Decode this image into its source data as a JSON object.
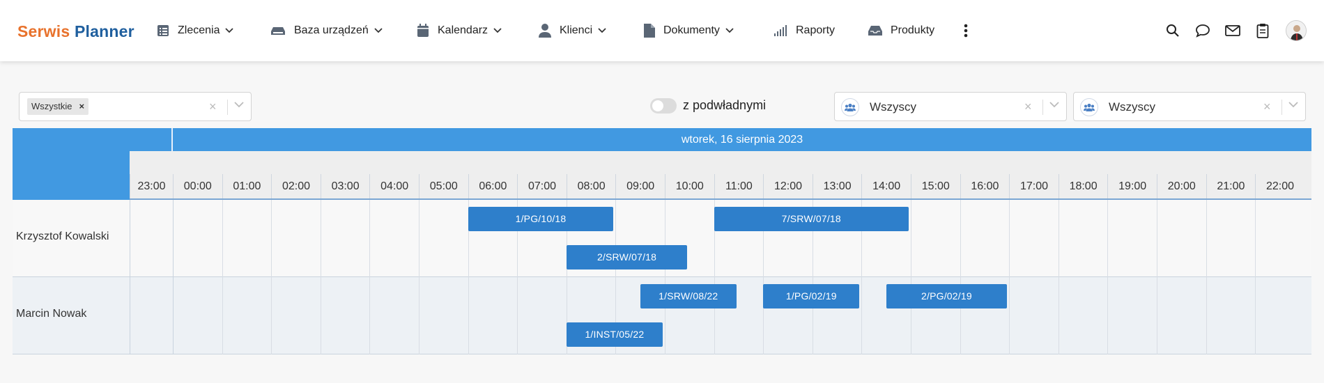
{
  "app": {
    "logo_part1": "Serwis",
    "logo_part2": "Planner"
  },
  "nav": [
    {
      "label": "Zlecenia",
      "icon": "list-icon",
      "dropdown": true
    },
    {
      "label": "Baza urządzeń",
      "icon": "printer-icon",
      "dropdown": true
    },
    {
      "label": "Kalendarz",
      "icon": "calendar-icon",
      "dropdown": true
    },
    {
      "label": "Klienci",
      "icon": "user-icon",
      "dropdown": true
    },
    {
      "label": "Dokumenty",
      "icon": "document-icon",
      "dropdown": true
    },
    {
      "label": "Raporty",
      "icon": "signal-bars-icon",
      "dropdown": false
    },
    {
      "label": "Produkty",
      "icon": "inbox-icon",
      "dropdown": false
    }
  ],
  "filters": {
    "status_chip": "Wszystkie",
    "toggle_label": "z podwładnymi",
    "group1_value": "Wszyscy",
    "group2_value": "Wszyscy"
  },
  "scheduler": {
    "date_label": "wtorek, 16 sierpnia 2023",
    "hours": [
      "23:00",
      "00:00",
      "01:00",
      "02:00",
      "03:00",
      "04:00",
      "05:00",
      "06:00",
      "07:00",
      "08:00",
      "09:00",
      "10:00",
      "11:00",
      "12:00",
      "13:00",
      "14:00",
      "15:00",
      "16:00",
      "17:00",
      "18:00",
      "19:00",
      "20:00",
      "21:00",
      "22:00"
    ],
    "rows": [
      {
        "name": "Krzysztof Kowalski"
      },
      {
        "name": "Marcin Nowak"
      }
    ],
    "events": [
      {
        "label": "1/PG/10/18"
      },
      {
        "label": "7/SRW/07/18"
      },
      {
        "label": "2/SRW/07/18"
      },
      {
        "label": "1/SRW/08/22"
      },
      {
        "label": "1/PG/02/19"
      },
      {
        "label": "2/PG/02/19"
      },
      {
        "label": "1/INST/05/22"
      }
    ]
  },
  "colors": {
    "accent": "#4199e1",
    "event": "#2e7fcb",
    "logo_orange": "#e8722c",
    "logo_blue": "#1f5f9e"
  }
}
